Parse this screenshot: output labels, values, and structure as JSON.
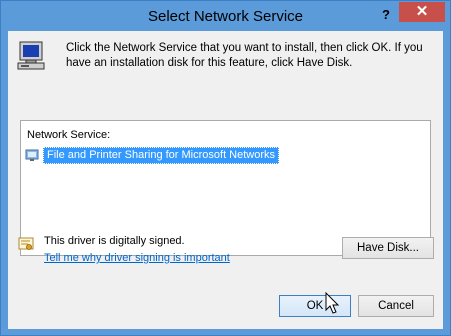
{
  "window": {
    "title": "Select Network Service",
    "help_label": "?",
    "close_label": "✕"
  },
  "instructions": "Click the Network Service that you want to install, then click OK. If you have an installation disk for this feature, click Have Disk.",
  "list": {
    "header": "Network Service:",
    "items": [
      {
        "label": "File and Printer Sharing for Microsoft Networks",
        "selected": true
      }
    ]
  },
  "signing": {
    "status_text": "This driver is digitally signed.",
    "link_text": "Tell me why driver signing is important"
  },
  "buttons": {
    "have_disk": "Have Disk...",
    "ok": "OK",
    "cancel": "Cancel"
  },
  "colors": {
    "title_bar": "#5b9bd9",
    "close_button": "#c7504b",
    "selection": "#3399ff",
    "link": "#0066cc"
  }
}
